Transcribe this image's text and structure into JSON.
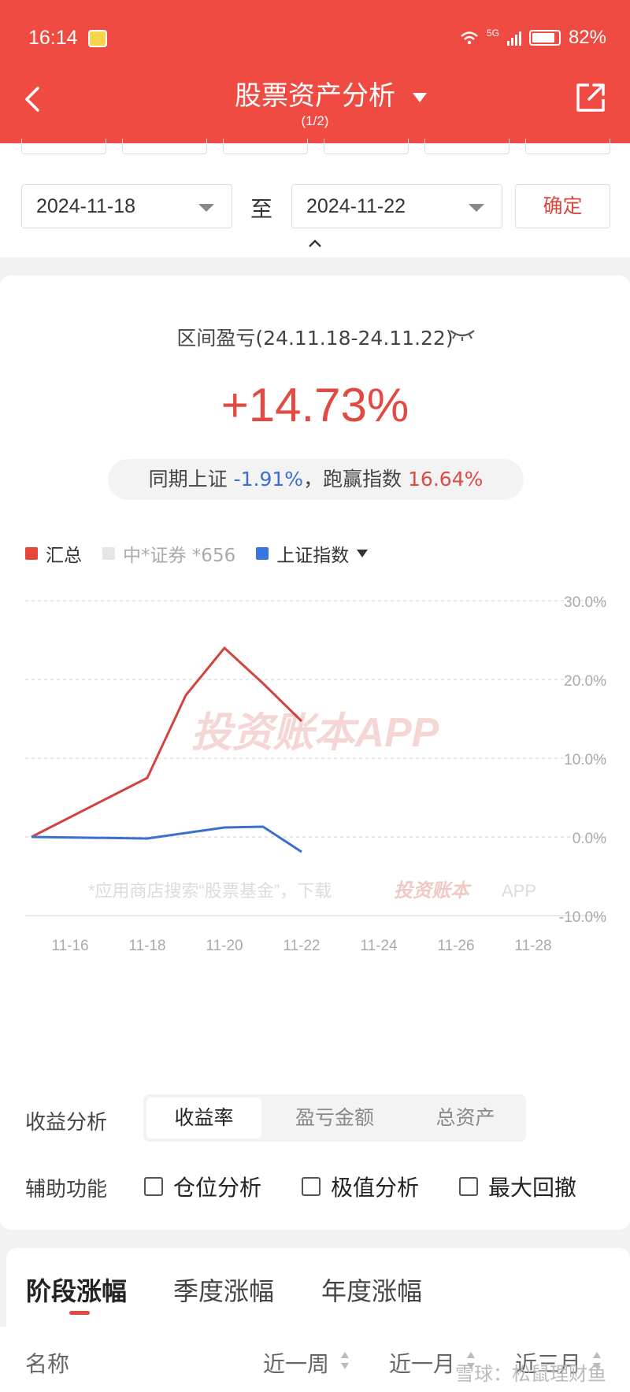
{
  "status_bar": {
    "time": "16:14",
    "network": "5G",
    "battery": "82%"
  },
  "header": {
    "title": "股票资产分析",
    "subtitle": "(1/2)"
  },
  "date_range": {
    "start": "2024-11-18",
    "separator": "至",
    "end": "2024-11-22",
    "confirm_label": "确定"
  },
  "summary": {
    "range_label": "区间盈亏(24.11.18-24.11.22)",
    "return_pct": "+14.73%",
    "compare_prefix": "同期上证",
    "index_return": "-1.91%",
    "compare_mid": "，跑赢指数",
    "excess_return": "16.64%"
  },
  "legend": [
    {
      "label": "汇总",
      "color": "#e8453c"
    },
    {
      "label": "中*证券 *656",
      "color": "#e6e6e6"
    },
    {
      "label": "上证指数",
      "color": "#3a74e0"
    }
  ],
  "watermarks": {
    "main": "投资账本APP",
    "search_hint": "*应用商店搜索“股票基金”，下载",
    "app_name": "投资账本",
    "app_suffix": "APP",
    "corner": "雪球：松鼠理财鱼"
  },
  "chart_data": {
    "type": "line",
    "x": [
      "11-18",
      "11-19",
      "11-20",
      "11-21",
      "11-22"
    ],
    "x_ticks": [
      "11-16",
      "11-18",
      "11-20",
      "11-22",
      "11-24",
      "11-26",
      "11-28"
    ],
    "x_range": [
      "11-15",
      "11-28"
    ],
    "y_ticks": [
      "30.0%",
      "20.0%",
      "10.0%",
      "0.0%",
      "-10.0%"
    ],
    "ylim": [
      -10,
      30
    ],
    "grid": true,
    "series": [
      {
        "name": "汇总",
        "color": "#d0453d",
        "points": [
          [
            "11-15",
            0.0
          ],
          [
            "11-18",
            7.5
          ],
          [
            "11-19",
            18.0
          ],
          [
            "11-20",
            24.0
          ],
          [
            "11-21",
            19.5
          ],
          [
            "11-22",
            14.7
          ]
        ]
      },
      {
        "name": "上证指数",
        "color": "#3a6fd0",
        "points": [
          [
            "11-15",
            0.0
          ],
          [
            "11-18",
            -0.2
          ],
          [
            "11-20",
            1.2
          ],
          [
            "11-21",
            1.3
          ],
          [
            "11-22",
            -1.9
          ]
        ]
      }
    ]
  },
  "analysis": {
    "label": "收益分析",
    "options": [
      "收益率",
      "盈亏金额",
      "总资产"
    ],
    "active": "收益率"
  },
  "aux": {
    "label": "辅助功能",
    "options": [
      "仓位分析",
      "极值分析",
      "最大回撤"
    ]
  },
  "bottom_tabs": [
    "阶段涨幅",
    "季度涨幅",
    "年度涨幅"
  ],
  "table_headers": [
    "名称",
    "近一周",
    "近一月",
    "近三月"
  ]
}
